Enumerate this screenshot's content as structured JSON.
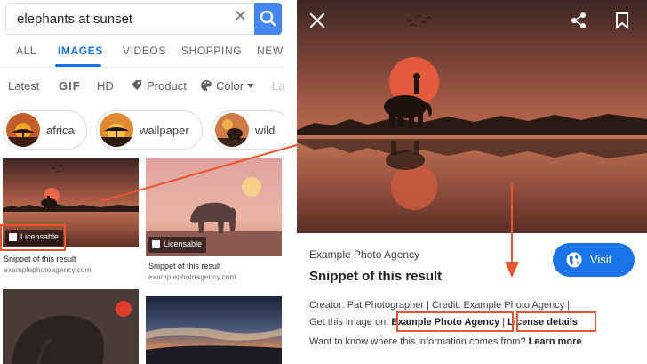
{
  "colors": {
    "accent": "#1a73e8",
    "annotation": "#e8542e",
    "search_button": "#4285f4"
  },
  "search": {
    "query": "elephants at sunset"
  },
  "tabs": [
    {
      "label": "ALL",
      "active": false
    },
    {
      "label": "IMAGES",
      "active": true
    },
    {
      "label": "VIDEOS",
      "active": false
    },
    {
      "label": "SHOPPING",
      "active": false
    },
    {
      "label": "NEWS",
      "active": false
    }
  ],
  "filters": {
    "latest": "Latest",
    "gif": "GIF",
    "hd": "HD",
    "product": "Product",
    "color": "Color",
    "labeled": "La"
  },
  "chips": [
    {
      "label": "africa",
      "icon": "acacia-sunset-thumbnail"
    },
    {
      "label": "wallpaper",
      "icon": "acacia-sunset-thumbnail"
    },
    {
      "label": "wild",
      "icon": "elephant-thumbnail"
    }
  ],
  "results": [
    {
      "badge": "Licensable",
      "snippet": "Snippet of this result",
      "domain": "examplephotoagency.com"
    },
    {
      "badge": "Licensable",
      "snippet": "Snippet of this result",
      "domain": "examplephotoagency.com"
    }
  ],
  "detail": {
    "agency": "Example Photo Agency",
    "title": "Snippet of this result",
    "visit_label": "Visit",
    "creator_line": "Creator: Pat Photographer | Credit: Example Photo Agency |",
    "get_image_prefix": "Get this image on:",
    "agency_link": "Example Photo Agency",
    "separator": "|",
    "license_link": "License details",
    "info_prefix": "Want to know where this information comes from?",
    "learn_more": "Learn more"
  }
}
